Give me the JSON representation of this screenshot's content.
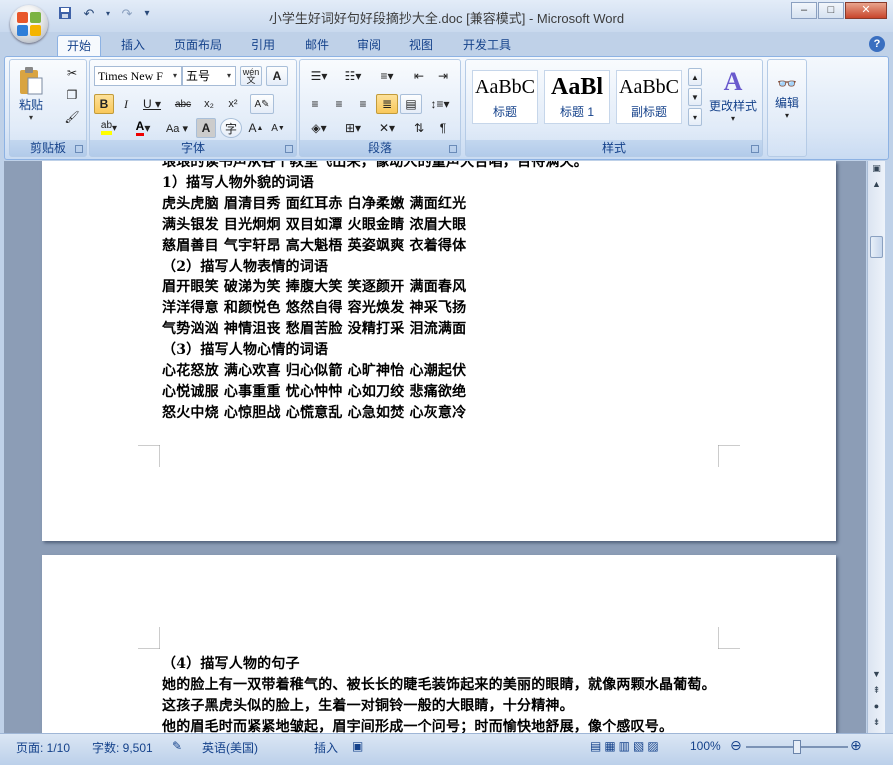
{
  "window": {
    "title": "小学生好词好句好段摘抄大全.doc [兼容模式] - Microsoft Word",
    "controls": {
      "minimize": "–",
      "maximize": "□",
      "close": "✕"
    }
  },
  "quick_access": {
    "save": "save-icon",
    "undo": "undo-icon",
    "redo": "redo-icon",
    "customize": "▾"
  },
  "ribbon_tabs": [
    "开始",
    "插入",
    "页面布局",
    "引用",
    "邮件",
    "审阅",
    "视图",
    "开发工具"
  ],
  "ribbon": {
    "clipboard": {
      "label": "剪贴板",
      "paste": "粘贴"
    },
    "font": {
      "label": "字体",
      "font_name": "Times New F",
      "font_size": "五号",
      "wen": "wén",
      "big_a": "A"
    },
    "paragraph": {
      "label": "段落"
    },
    "styles": {
      "label": "样式",
      "items": [
        {
          "preview": "AaBbC",
          "name": "标题"
        },
        {
          "preview": "AaBl",
          "name": "标题 1"
        },
        {
          "preview": "AaBbC",
          "name": "副标题"
        }
      ],
      "change_styles": "更改样式"
    },
    "editing": {
      "label": "编辑"
    }
  },
  "document": {
    "page1_lines": [
      "琅琅的读书声从各个教室飞出来，像动人的童声大合唱，百待满天。",
      "1）描写人物外貌的词语",
      "虎头虎脑 眉清目秀 面红耳赤 白净柔嫩 满面红光",
      "满头银发 目光炯炯 双目如潭 火眼金睛 浓眉大眼",
      "慈眉善目 气宇轩昂 高大魁梧 英姿飒爽 衣着得体",
      "（2）描写人物表情的词语",
      "眉开眼笑 破涕为笑 捧腹大笑 笑逐颜开 满面春风",
      "洋洋得意 和颜悦色 悠然自得 容光焕发 神采飞扬",
      "气势汹汹 神情沮丧 愁眉苦脸 没精打采 泪流满面",
      "（3）描写人物心情的词语",
      "心花怒放 满心欢喜 归心似箭 心旷神怡 心潮起伏",
      "心悦诚服 心事重重 忧心忡忡 心如刀绞 悲痛欲绝",
      "怒火中烧 心惊胆战 心慌意乱 心急如焚 心灰意冷"
    ],
    "page2_lines": [
      "（4）描写人物的句子",
      "她的脸上有一双带着稚气的、被长长的睫毛装饰起来的美丽的眼睛，就像两颗水晶葡萄。",
      "这孩子黑虎头似的脸上，生着一对铜铃一般的大眼睛，十分精神。",
      "他的眉毛时而紧紧地皱起，眉宇间形成一个问号；时而愉快地舒展，像个感叹号。"
    ]
  },
  "status": {
    "page": "页面: 1/10",
    "words": "字数: 9,501",
    "language": "英语(美国)",
    "mode": "插入",
    "zoom": "100%",
    "zoom_level": 1.0
  }
}
